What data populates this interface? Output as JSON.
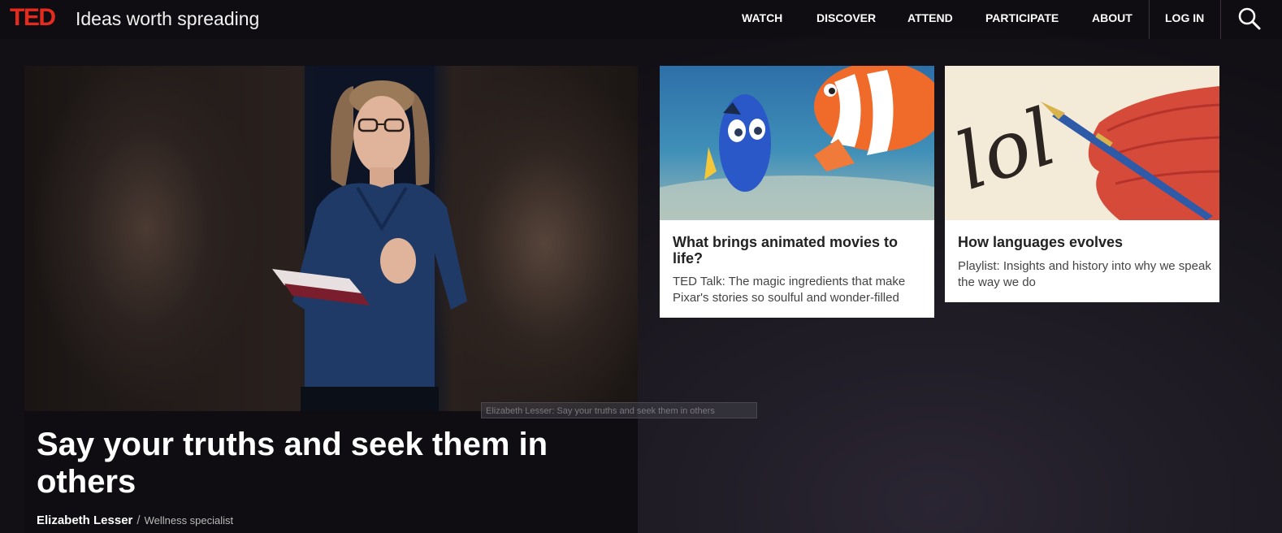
{
  "header": {
    "logo": "TED",
    "tagline": "Ideas worth spreading",
    "nav": [
      "WATCH",
      "DISCOVER",
      "ATTEND",
      "PARTICIPATE",
      "ABOUT",
      "LOG IN"
    ],
    "brand_color": "#e62b1e"
  },
  "hero": {
    "title": "Say your truths and seek them in others",
    "speaker_name": "Elizabeth Lesser",
    "separator": "/",
    "speaker_role": "Wellness specialist",
    "tooltip": "Elizabeth Lesser: Say your truths and seek them in others"
  },
  "cards": [
    {
      "title": "What brings animated movies to life?",
      "description": "TED Talk: The magic ingredients that make Pixar's stories so soulful and wonder-filled"
    },
    {
      "title": "How languages evolves",
      "description": "Playlist: Insights and history into why we speak the way we do",
      "image_text": "lol"
    }
  ],
  "icons": {
    "search": "search-icon"
  }
}
